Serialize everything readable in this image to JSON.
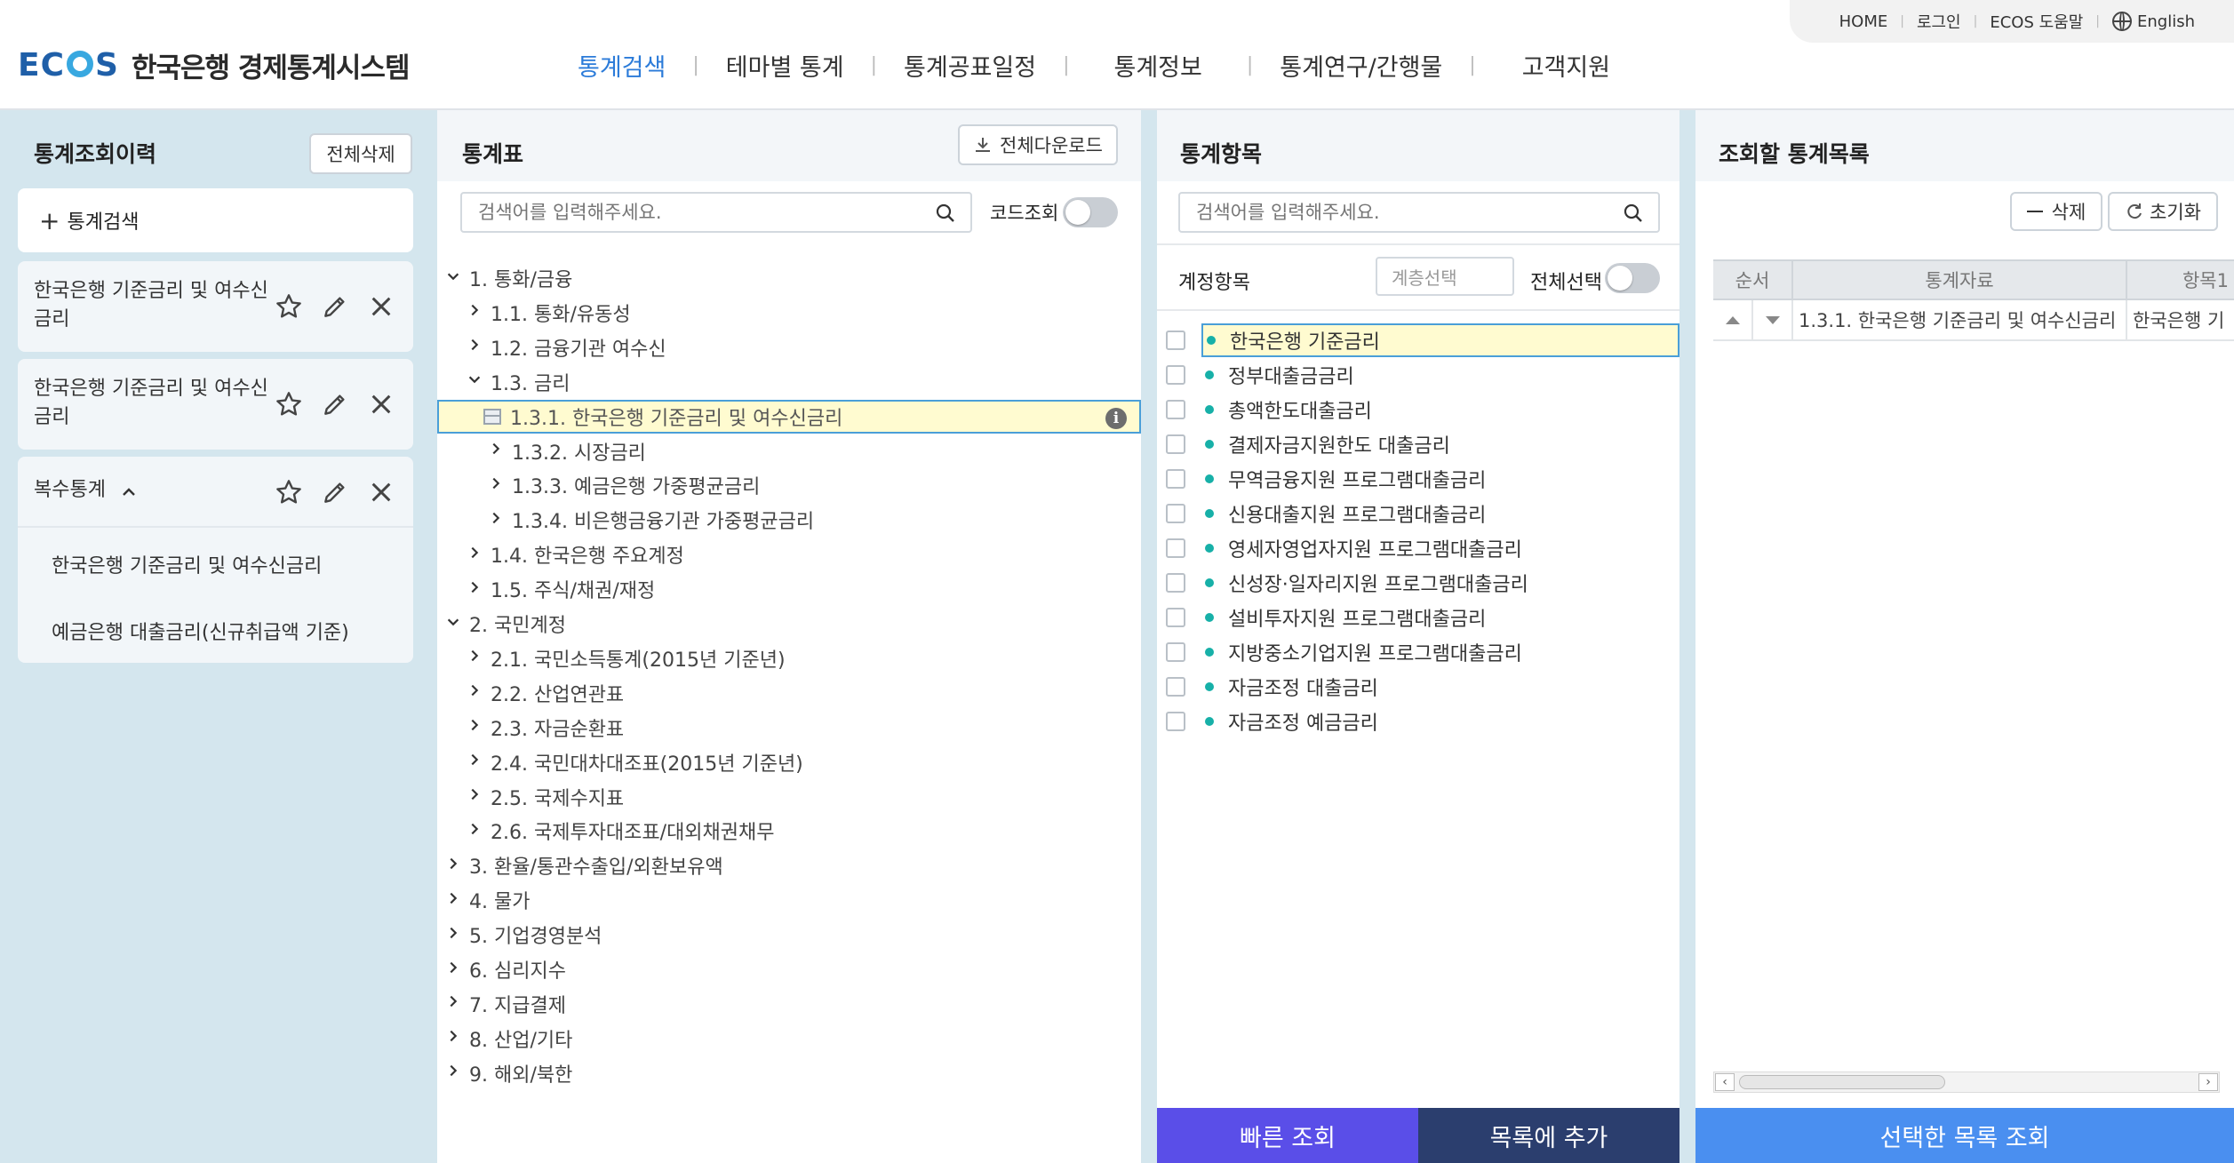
{
  "header": {
    "logo_text": "ECOS",
    "logo_title": "한국은행 경제통계시스템",
    "nav": [
      "통계검색",
      "테마별 통계",
      "통계공표일정",
      "통계정보",
      "통계연구/간행물",
      "고객지원"
    ],
    "util": [
      "HOME",
      "로그인",
      "ECOS 도움말",
      "English"
    ]
  },
  "history": {
    "title": "통계조회이력",
    "delete_all": "전체삭제",
    "new_search": "통계검색",
    "cards": [
      {
        "label": "한국은행 기준금리 및 여수신 금리"
      },
      {
        "label": "한국은행 기준금리 및 여수신 금리"
      }
    ],
    "multi": {
      "label": "복수통계",
      "items": [
        "한국은행 기준금리 및 여수신금리",
        "예금은행 대출금리(신규취급액 기준)"
      ]
    }
  },
  "stat_table": {
    "title": "통계표",
    "download_all": "전체다운로드",
    "search_placeholder": "검색어를 입력해주세요.",
    "code_lookup": "코드조회",
    "tree": [
      {
        "label": "1. 통화/금융",
        "level": 0,
        "open": true
      },
      {
        "label": "1.1. 통화/유동성",
        "level": 1,
        "open": false
      },
      {
        "label": "1.2. 금융기관 여수신",
        "level": 1,
        "open": false
      },
      {
        "label": "1.3. 금리",
        "level": 1,
        "open": true
      },
      {
        "label": "1.3.1. 한국은행 기준금리 및 여수신금리",
        "level": 2,
        "selected": true
      },
      {
        "label": "1.3.2. 시장금리",
        "level": 2,
        "open": false
      },
      {
        "label": "1.3.3. 예금은행 가중평균금리",
        "level": 2,
        "open": false
      },
      {
        "label": "1.3.4. 비은행금융기관 가중평균금리",
        "level": 2,
        "open": false
      },
      {
        "label": "1.4. 한국은행 주요계정",
        "level": 1,
        "open": false
      },
      {
        "label": "1.5. 주식/채권/재정",
        "level": 1,
        "open": false
      },
      {
        "label": "2. 국민계정",
        "level": 0,
        "open": true
      },
      {
        "label": "2.1. 국민소득통계(2015년 기준년)",
        "level": 1,
        "open": false
      },
      {
        "label": "2.2. 산업연관표",
        "level": 1,
        "open": false
      },
      {
        "label": "2.3. 자금순환표",
        "level": 1,
        "open": false
      },
      {
        "label": "2.4. 국민대차대조표(2015년 기준년)",
        "level": 1,
        "open": false
      },
      {
        "label": "2.5. 국제수지표",
        "level": 1,
        "open": false
      },
      {
        "label": "2.6. 국제투자대조표/대외채권채무",
        "level": 1,
        "open": false
      },
      {
        "label": "3. 환율/통관수출입/외환보유액",
        "level": 0,
        "open": false
      },
      {
        "label": "4. 물가",
        "level": 0,
        "open": false
      },
      {
        "label": "5. 기업경영분석",
        "level": 0,
        "open": false
      },
      {
        "label": "6. 심리지수",
        "level": 0,
        "open": false
      },
      {
        "label": "7. 지급결제",
        "level": 0,
        "open": false
      },
      {
        "label": "8. 산업/기타",
        "level": 0,
        "open": false
      },
      {
        "label": "9. 해외/북한",
        "level": 0,
        "open": false
      }
    ]
  },
  "stat_items": {
    "title": "통계항목",
    "search_placeholder": "검색어를 입력해주세요.",
    "account_label": "계정항목",
    "layer_select": "계층선택",
    "select_all": "전체선택",
    "items": [
      "한국은행 기준금리",
      "정부대출금금리",
      "총액한도대출금리",
      "결제자금지원한도 대출금리",
      "무역금융지원 프로그램대출금리",
      "신용대출지원 프로그램대출금리",
      "영세자영업자지원 프로그램대출금리",
      "신성장·일자리지원 프로그램대출금리",
      "설비투자지원 프로그램대출금리",
      "지방중소기업지원 프로그램대출금리",
      "자금조정 대출금리",
      "자금조정 예금금리"
    ],
    "quick_search": "빠른 조회",
    "add_to_list": "목록에 추가"
  },
  "query_list": {
    "title": "조회할 통계목록",
    "delete": "삭제",
    "reset": "초기화",
    "columns": [
      "순서",
      "통계자료",
      "항목1"
    ],
    "rows": [
      {
        "data": "1.3.1. 한국은행 기준금리 및 여수신금리",
        "item1": "한국은행 기"
      }
    ],
    "submit": "선택한 목록 조회"
  },
  "colors": {
    "accent_blue": "#2b7bd9",
    "btn_purple": "#5a4ee8",
    "btn_navy": "#2b3e6e",
    "btn_sky": "#4a8ff0",
    "side_bg": "#d4e6ee",
    "highlight": "#fffbd0"
  }
}
